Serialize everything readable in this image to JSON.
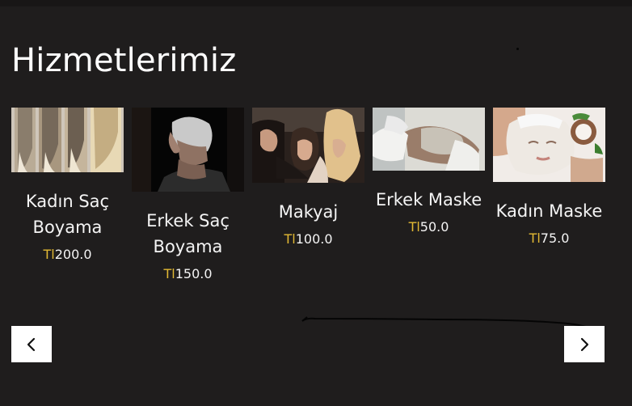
{
  "section": {
    "title": "Hizmetlerimiz"
  },
  "services": [
    {
      "name": "Kadın Saç Boyama",
      "currency": "Tl",
      "price": "200.0",
      "image": "hair-color-samples-photo"
    },
    {
      "name": "Erkek Saç Boyama",
      "currency": "Tl",
      "price": "150.0",
      "image": "men-hair-color-photo"
    },
    {
      "name": "Makyaj",
      "currency": "Tl",
      "price": "100.0",
      "image": "makeup-photo"
    },
    {
      "name": "Erkek Maske",
      "currency": "Tl",
      "price": "50.0",
      "image": "men-face-mask-photo"
    },
    {
      "name": "Kadın Maske",
      "currency": "Tl",
      "price": "75.0",
      "image": "women-face-mask-photo"
    }
  ],
  "carousel": {
    "prev_icon": "chevron-left-icon",
    "next_icon": "chevron-right-icon"
  },
  "colors": {
    "background": "#1f1d1d",
    "text": "#ffffff",
    "currency": "#e2b934",
    "button": "#ffffff"
  }
}
